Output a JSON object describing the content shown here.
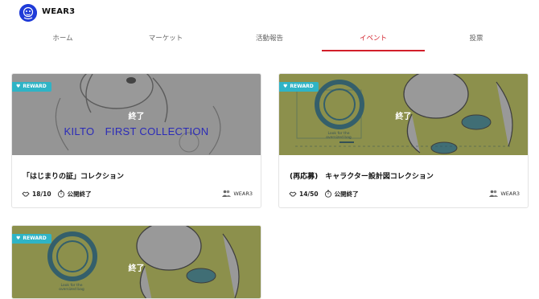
{
  "app": {
    "title": "WEAR3"
  },
  "tabs": [
    {
      "label": "ホーム",
      "active": false
    },
    {
      "label": "マーケット",
      "active": false
    },
    {
      "label": "活動報告",
      "active": false
    },
    {
      "label": "イベント",
      "active": true
    },
    {
      "label": "投票",
      "active": false
    }
  ],
  "colors": {
    "accent": "#d21f2a",
    "reward_badge": "#2fb4c6",
    "logo": "#1f3bd8"
  },
  "cards": [
    {
      "badge": "REWARD",
      "status": "終了",
      "image_text": "KILTO　FIRST COLLECTION",
      "title": "「はじまりの証」コレクション",
      "count": "18/10",
      "state": "公開終了",
      "owner": "WEAR3"
    },
    {
      "badge": "REWARD",
      "status": "終了",
      "image_text": "Look for the oversized bag",
      "title": "(再応募)　キャラクター設計図コレクション",
      "count": "14/50",
      "state": "公開終了",
      "owner": "WEAR3"
    },
    {
      "badge": "REWARD",
      "status": "終了",
      "image_text": "Look for the oversized bag"
    }
  ]
}
